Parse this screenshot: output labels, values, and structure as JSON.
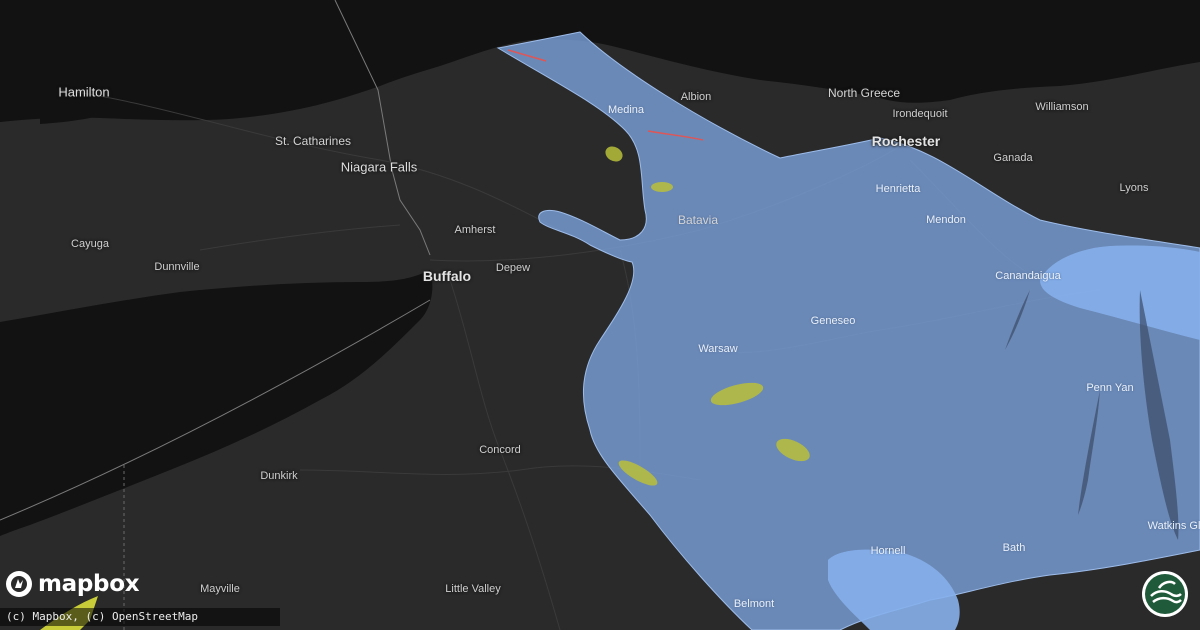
{
  "map": {
    "theme": "dark",
    "colors": {
      "land": "#2a2a2a",
      "water": "#121212",
      "alert_fill": "#7ea4df",
      "alert_core_fill": "#86b0ec",
      "hail_spot": "#b8bf3a",
      "tornado_track": "#e05555"
    },
    "places": [
      {
        "name": "Hamilton",
        "kind": "city-l"
      },
      {
        "name": "St. Catharines",
        "kind": "mid"
      },
      {
        "name": "Niagara Falls",
        "kind": "city-l"
      },
      {
        "name": "Cayuga",
        "kind": "town"
      },
      {
        "name": "Dunnville",
        "kind": "town"
      },
      {
        "name": "Amherst",
        "kind": "town"
      },
      {
        "name": "Buffalo",
        "kind": "city"
      },
      {
        "name": "Depew",
        "kind": "town"
      },
      {
        "name": "Medina",
        "kind": "town"
      },
      {
        "name": "Albion",
        "kind": "town"
      },
      {
        "name": "Batavia",
        "kind": "mid"
      },
      {
        "name": "North Greece",
        "kind": "mid"
      },
      {
        "name": "Irondequoit",
        "kind": "town"
      },
      {
        "name": "Rochester",
        "kind": "city"
      },
      {
        "name": "Williamson",
        "kind": "town"
      },
      {
        "name": "Henrietta",
        "kind": "town"
      },
      {
        "name": "Ganada",
        "kind": "town"
      },
      {
        "name": "Mendon",
        "kind": "town"
      },
      {
        "name": "Lyons",
        "kind": "town"
      },
      {
        "name": "Canandaigua",
        "kind": "town"
      },
      {
        "name": "Geneseo",
        "kind": "town"
      },
      {
        "name": "Warsaw",
        "kind": "town"
      },
      {
        "name": "Penn Yan",
        "kind": "town"
      },
      {
        "name": "Concord",
        "kind": "town"
      },
      {
        "name": "Dunkirk",
        "kind": "town"
      },
      {
        "name": "Hornell",
        "kind": "town"
      },
      {
        "name": "Bath",
        "kind": "town"
      },
      {
        "name": "Watkins Gl",
        "kind": "town"
      },
      {
        "name": "Mayville",
        "kind": "town"
      },
      {
        "name": "Little Valley",
        "kind": "town"
      },
      {
        "name": "Belmont",
        "kind": "town"
      }
    ]
  },
  "attribution": "(c) Mapbox, (c) OpenStreetMap",
  "logo": {
    "text": "mapbox",
    "icon": "mapbox-icon"
  },
  "badge": {
    "icon": "weather-brand-icon"
  }
}
